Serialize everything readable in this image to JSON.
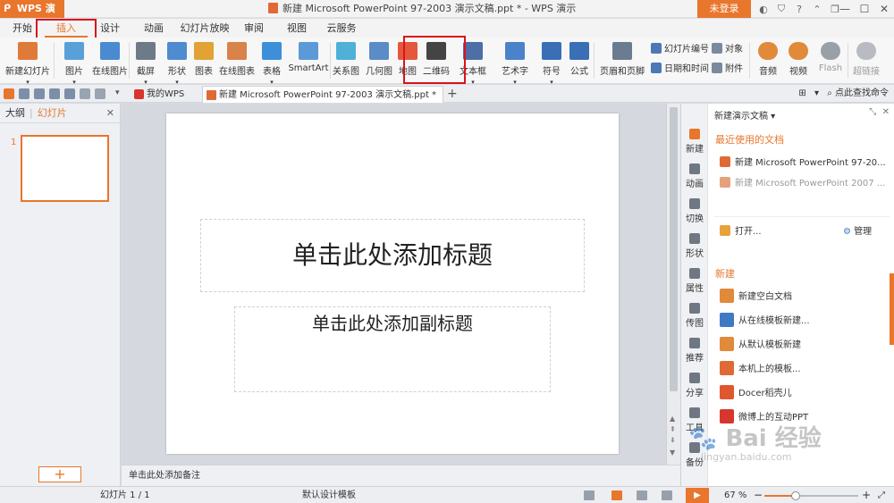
{
  "titlebar": {
    "app_name": "WPS 演示",
    "window_title": "新建 Microsoft PowerPoint 97-2003 演示文稿.ppt * - WPS 演示",
    "login_label": "未登录",
    "icons": [
      "save-icon",
      "print-icon",
      "undo-icon",
      "redo-icon"
    ]
  },
  "menu": {
    "tabs": [
      "开始",
      "插入",
      "设计",
      "动画",
      "幻灯片放映",
      "审阅",
      "视图",
      "云服务"
    ],
    "active": "插入"
  },
  "ribbon": {
    "buttons": [
      {
        "label": "新建幻灯片",
        "color": "#e07a3a",
        "dropdown": true
      },
      {
        "label": "图片",
        "color": "#5aa0d8",
        "dropdown": true
      },
      {
        "label": "在线图片",
        "color": "#4a8ad0",
        "dropdown": false
      },
      {
        "label": "截屏",
        "color": "#6d7a88",
        "dropdown": true
      },
      {
        "label": "形状",
        "color": "#4f8bd1",
        "dropdown": true
      },
      {
        "label": "图表",
        "color": "#e2a236",
        "dropdown": false
      },
      {
        "label": "在线图表",
        "color": "#d9824a",
        "dropdown": false
      },
      {
        "label": "表格",
        "color": "#3c8fd8",
        "dropdown": true
      },
      {
        "label": "SmartArt",
        "color": "#5b9ad6",
        "dropdown": false
      },
      {
        "label": "关系图",
        "color": "#4fb0d8",
        "dropdown": false
      },
      {
        "label": "几何图",
        "color": "#5c8cc7",
        "dropdown": false
      },
      {
        "label": "地图",
        "color": "#e5573c",
        "dropdown": false
      },
      {
        "label": "二维码",
        "color": "#444444",
        "dropdown": false
      },
      {
        "label": "文本框",
        "color": "#4d6fa6",
        "dropdown": true
      },
      {
        "label": "艺术字",
        "color": "#4a83c9",
        "dropdown": true
      },
      {
        "label": "符号",
        "color": "#3a6fb5",
        "dropdown": true
      },
      {
        "label": "公式",
        "color": "#3a6fb5",
        "dropdown": false
      },
      {
        "label": "页眉和页脚",
        "color": "#6b7c90",
        "dropdown": false
      }
    ],
    "small_buttons": [
      "幻灯片编号",
      "对象",
      "日期和时间",
      "附件"
    ],
    "media_buttons": [
      {
        "label": "音频",
        "color": "#e08a3a",
        "dropdown": true
      },
      {
        "label": "视频",
        "color": "#e08a3a",
        "dropdown": true
      },
      {
        "label": "Flash",
        "color": "#9aa0a8",
        "dropdown": false
      },
      {
        "label": "超链接",
        "color": "#b8bcc2",
        "dropdown": false
      }
    ]
  },
  "docbar": {
    "tabs": [
      "我的WPS",
      "新建 Microsoft PowerPoint 97-2003 演示文稿.ppt *"
    ],
    "add_label": "+",
    "search_label": "点此查找命令"
  },
  "leftpanel": {
    "tab_outline": "大纲",
    "tab_slides": "幻灯片",
    "slide_number": "1",
    "add_label": "+"
  },
  "slide": {
    "title_placeholder": "单击此处添加标题",
    "subtitle_placeholder": "单击此处添加副标题"
  },
  "notes": "单击此处添加备注",
  "rightpane": {
    "header": "新建演示文稿",
    "nav": [
      "新建",
      "动画",
      "切换",
      "形状",
      "属性",
      "传图",
      "推荐",
      "分享",
      "工具",
      "备份"
    ],
    "recent_title": "最近使用的文档",
    "recent": [
      {
        "label": "新建 Microsoft PowerPoint 97-20...",
        "color": "#e06a35"
      },
      {
        "label": "新建 Microsoft PowerPoint 2007 ...",
        "color": "#e3a27a"
      }
    ],
    "open_label": "打开...",
    "manage_label": "管理",
    "new_title": "新建",
    "new_items": [
      {
        "label": "新建空白文档",
        "color": "#e08a3a"
      },
      {
        "label": "从在线模板新建...",
        "color": "#3e79c6"
      },
      {
        "label": "从默认模板新建",
        "color": "#e08a3a"
      },
      {
        "label": "本机上的模板...",
        "color": "#e06a35"
      },
      {
        "label": "Docer稻壳儿",
        "color": "#e0572d"
      },
      {
        "label": "微博上的互动PPT",
        "color": "#d6362d"
      }
    ]
  },
  "statusbar": {
    "slide_info": "幻灯片 1 / 1",
    "template": "默认设计模板",
    "zoom": "67 %",
    "zoom_percent": 67
  },
  "colors": {
    "accent": "#e8762c",
    "highlight_box": "#d9141b"
  },
  "watermark": {
    "main": "Bai 经验",
    "sub": "jingyan.baidu.com"
  }
}
